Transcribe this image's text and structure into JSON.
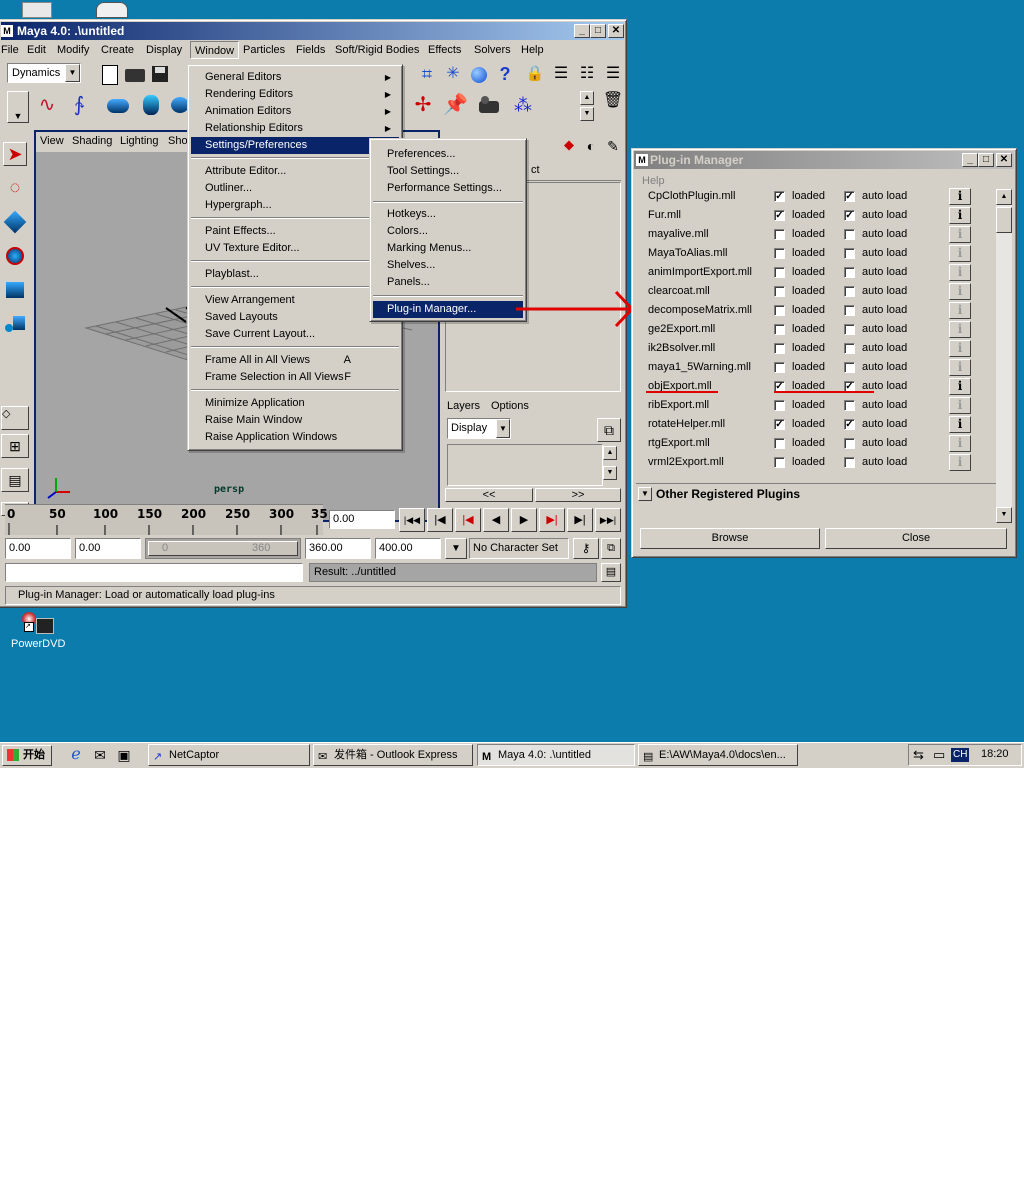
{
  "desktop": {
    "background": "#0b7cac",
    "powerdvd_label": "PowerDVD"
  },
  "maya": {
    "title": "Maya 4.0: .\\untitled",
    "menus": [
      "File",
      "Edit",
      "Modify",
      "Create",
      "Display",
      "Window",
      "Particles",
      "Fields",
      "Soft/Rigid Bodies",
      "Effects",
      "Solvers",
      "Help"
    ],
    "mode_select": "Dynamics",
    "viewport_menus": [
      "View",
      "Shading",
      "Lighting",
      "Show"
    ],
    "camera_label": "persp",
    "layers_menus": [
      "Layers",
      "Options"
    ],
    "layers_select": "Display",
    "scroll_left": "<<",
    "scroll_right": ">>",
    "timeline_ticks": [
      "0",
      "50",
      "100",
      "150",
      "200",
      "250",
      "300",
      "35"
    ],
    "current_time": "0.00",
    "range_start": "0.00",
    "range_start2": "0.00",
    "range_slider_start": "0",
    "range_slider_end": "360",
    "range_end": "360.00",
    "range_end2": "400.00",
    "character_set": "No Character Set",
    "command_result": "Result: ../untitled",
    "help_line": "Plug-in Manager: Load or automatically load plug-ins",
    "channel_box_fragment": "ct"
  },
  "window_menu": {
    "items": [
      {
        "label": "General Editors",
        "arrow": true
      },
      {
        "label": "Rendering Editors",
        "arrow": true
      },
      {
        "label": "Animation Editors",
        "arrow": true
      },
      {
        "label": "Relationship Editors",
        "arrow": true
      },
      {
        "label": "Settings/Preferences",
        "arrow": true,
        "selected": true
      },
      {
        "label": "Attribute Editor..."
      },
      {
        "label": "Outliner..."
      },
      {
        "label": "Hypergraph..."
      },
      {
        "label": "Paint Effects..."
      },
      {
        "label": "UV Texture Editor..."
      },
      {
        "label": "Playblast..."
      },
      {
        "label": "View Arrangement",
        "arrow": true
      },
      {
        "label": "Saved Layouts",
        "arrow": true
      },
      {
        "label": "Save Current Layout..."
      },
      {
        "label": "Frame All in All Views",
        "accel": "A"
      },
      {
        "label": "Frame Selection in All Views",
        "accel": "F"
      },
      {
        "label": "Minimize Application"
      },
      {
        "label": "Raise Main Window"
      },
      {
        "label": "Raise Application Windows"
      }
    ]
  },
  "settings_submenu": {
    "items": [
      {
        "label": "Preferences..."
      },
      {
        "label": "Tool Settings..."
      },
      {
        "label": "Performance Settings..."
      },
      {
        "label": "Hotkeys..."
      },
      {
        "label": "Colors..."
      },
      {
        "label": "Marking Menus..."
      },
      {
        "label": "Shelves..."
      },
      {
        "label": "Panels..."
      },
      {
        "label": "Plug-in Manager...",
        "selected": true
      }
    ]
  },
  "plugin_manager": {
    "title": "Plug-in Manager",
    "help_menu": "Help",
    "loaded_label": "loaded",
    "autoload_label": "auto load",
    "plugins": [
      {
        "name": "CpClothPlugin.mll",
        "loaded": true,
        "auto": true
      },
      {
        "name": "Fur.mll",
        "loaded": true,
        "auto": true
      },
      {
        "name": "mayalive.mll",
        "loaded": false,
        "auto": false
      },
      {
        "name": "MayaToAlias.mll",
        "loaded": false,
        "auto": false
      },
      {
        "name": "animImportExport.mll",
        "loaded": false,
        "auto": false
      },
      {
        "name": "clearcoat.mll",
        "loaded": false,
        "auto": false
      },
      {
        "name": "decomposeMatrix.mll",
        "loaded": false,
        "auto": false
      },
      {
        "name": "ge2Export.mll",
        "loaded": false,
        "auto": false
      },
      {
        "name": "ik2Bsolver.mll",
        "loaded": false,
        "auto": false
      },
      {
        "name": "maya1_5Warning.mll",
        "loaded": false,
        "auto": false
      },
      {
        "name": "objExport.mll",
        "loaded": true,
        "auto": true
      },
      {
        "name": "ribExport.mll",
        "loaded": false,
        "auto": false
      },
      {
        "name": "rotateHelper.mll",
        "loaded": true,
        "auto": true
      },
      {
        "name": "rtgExport.mll",
        "loaded": false,
        "auto": false
      },
      {
        "name": "vrml2Export.mll",
        "loaded": false,
        "auto": false
      }
    ],
    "other_section": "Other Registered Plugins",
    "browse_label": "Browse",
    "close_label": "Close",
    "annotation_color": "#e00000"
  },
  "taskbar": {
    "start_label": "开始",
    "tasks": [
      "NetCaptor",
      "发件箱 - Outlook Express",
      "Maya 4.0: .\\untitled",
      "E:\\AW\\Maya4.0\\docs\\en..."
    ],
    "ime": "CH",
    "clock": "18:20"
  }
}
